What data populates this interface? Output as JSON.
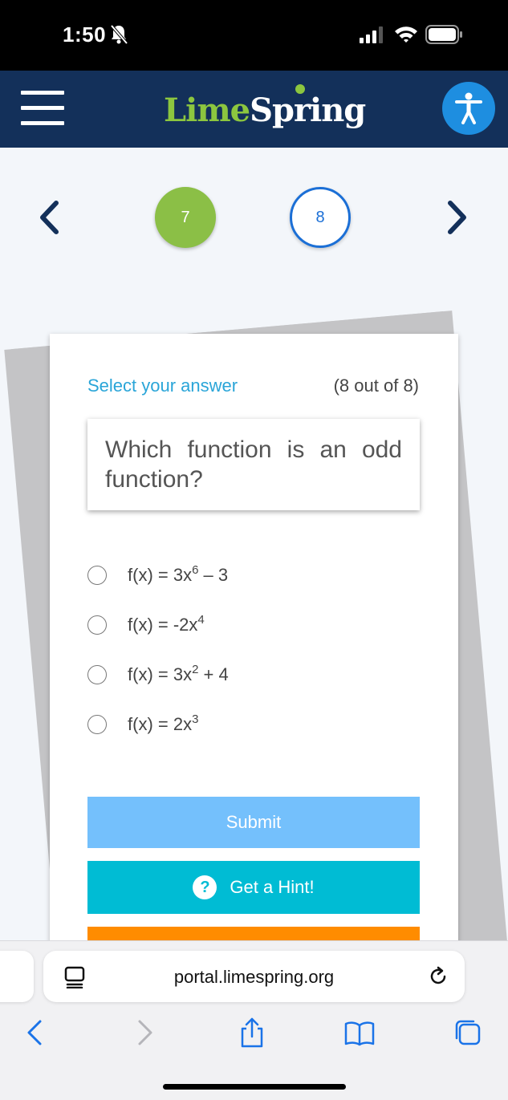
{
  "status_bar": {
    "time": "1:50"
  },
  "header": {
    "brand_part1": "Lime",
    "brand_part2": "Spring",
    "colors": {
      "header_bg": "#13305a",
      "brand_green": "#8cc63f",
      "accessibility_blue": "#1e8ee0"
    }
  },
  "nav": {
    "questions": [
      {
        "number": "7",
        "state": "completed"
      },
      {
        "number": "8",
        "state": "current"
      }
    ]
  },
  "card": {
    "prompt": "Select your answer",
    "progress": "(8 out of 8)",
    "question": "Which function is an odd function?",
    "options": [
      {
        "base": "f(x) = 3x",
        "exp": "6",
        "tail": " – 3"
      },
      {
        "base": "f(x) = -2x",
        "exp": "4",
        "tail": ""
      },
      {
        "base": "f(x) = 3x",
        "exp": "2",
        "tail": " + 4"
      },
      {
        "base": "f(x) = 2x",
        "exp": "3",
        "tail": ""
      }
    ],
    "submit_label": "Submit",
    "hint_icon": "?",
    "hint_label": "Get a Hint!",
    "colors": {
      "submit": "#74c0fc",
      "hint": "#00bcd4",
      "third": "#ff8c00"
    }
  },
  "browser": {
    "url": "portal.limespring.org"
  }
}
